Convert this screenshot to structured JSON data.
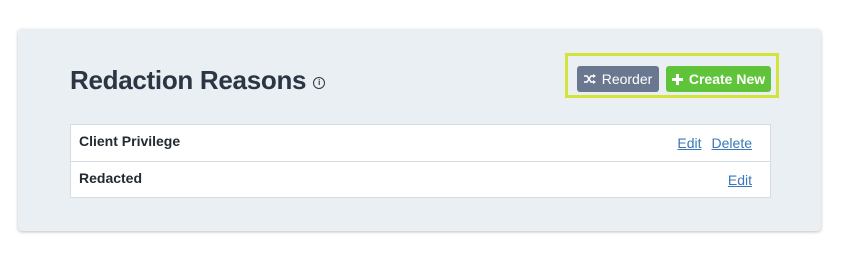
{
  "page": {
    "title": "Redaction Reasons",
    "info_glyph": "i"
  },
  "toolbar": {
    "reorder_label": "Reorder",
    "create_label": "Create New"
  },
  "reasons": [
    {
      "name": "Client Privilege",
      "actions": [
        "Edit",
        "Delete"
      ]
    },
    {
      "name": "Redacted",
      "actions": [
        "Edit"
      ]
    }
  ],
  "colors": {
    "panel_bg": "#e9eff3",
    "title": "#2b3543",
    "reorder_bg": "#6a788f",
    "create_bg": "#60c43b",
    "highlight": "#d3e33a",
    "link": "#3b78b8"
  },
  "icons": {
    "reorder": "shuffle-icon",
    "create": "plus-icon",
    "info": "info-icon"
  }
}
